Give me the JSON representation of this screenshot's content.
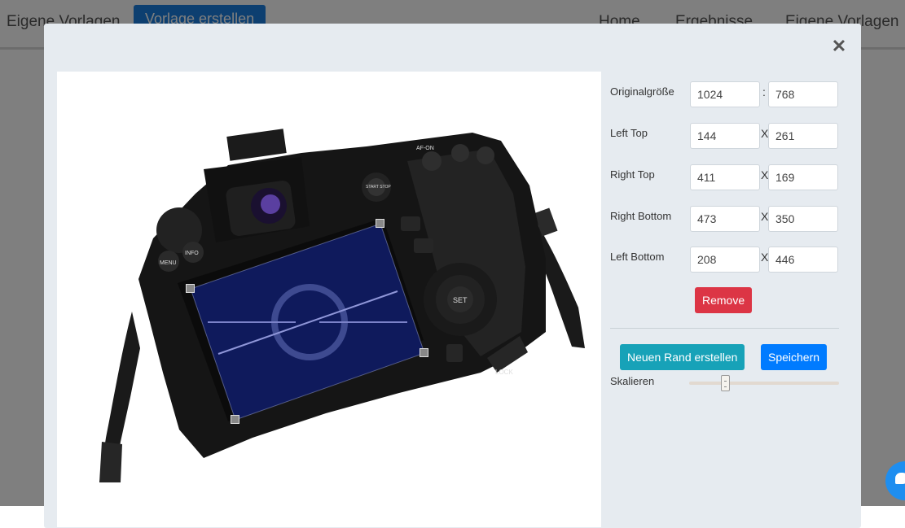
{
  "background": {
    "nav_left": "Eigene Vorlagen",
    "create_button": "Vorlage erstellen",
    "nav_home": "Home",
    "nav_results": "Ergebnisse",
    "nav_templates": "Eigene Vorlagen"
  },
  "modal": {
    "close_glyph": "✕"
  },
  "panel": {
    "original_size": {
      "label": "Originalgröße",
      "width": "1024",
      "height": "768",
      "separator": ":"
    },
    "left_top": {
      "label": "Left Top",
      "x": "144",
      "y": "261",
      "separator": "X"
    },
    "right_top": {
      "label": "Right Top",
      "x": "411",
      "y": "169",
      "separator": "X"
    },
    "right_bottom": {
      "label": "Right Bottom",
      "x": "473",
      "y": "350",
      "separator": "X"
    },
    "left_bottom": {
      "label": "Left Bottom",
      "x": "208",
      "y": "446",
      "separator": "X"
    },
    "remove_button": "Remove",
    "new_border_button": "Neuen Rand erstellen",
    "save_button": "Speichern",
    "scale_label": "Skalieren",
    "scale_value": 0.24
  },
  "camera_labels": {
    "menu": "MENU",
    "info": "INFO",
    "af_on": "AF-ON",
    "start_stop": "START STOP",
    "set": "SET",
    "lock": "LOCK"
  },
  "colors": {
    "remove": "#dc3545",
    "new_border": "#17a2b8",
    "save": "#007bff"
  }
}
